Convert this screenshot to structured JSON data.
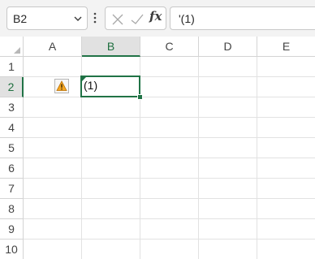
{
  "formula_bar": {
    "name_box": "B2",
    "formula": "'(1)",
    "cancel_icon": "close-icon",
    "enter_icon": "checkmark-icon",
    "insert_function_label": "fx"
  },
  "columns": [
    "A",
    "B",
    "C",
    "D",
    "E"
  ],
  "rows": [
    "1",
    "2",
    "3",
    "4",
    "5",
    "6",
    "7",
    "8",
    "9",
    "10"
  ],
  "active_cell": {
    "column": "B",
    "row": "2",
    "display_value": "(1)"
  },
  "error_indicator": {
    "icon": "warning-icon",
    "cell": "A2"
  },
  "colors": {
    "accent": "#217346",
    "warning": "#f5a623",
    "gridline": "#e2e2e2"
  }
}
